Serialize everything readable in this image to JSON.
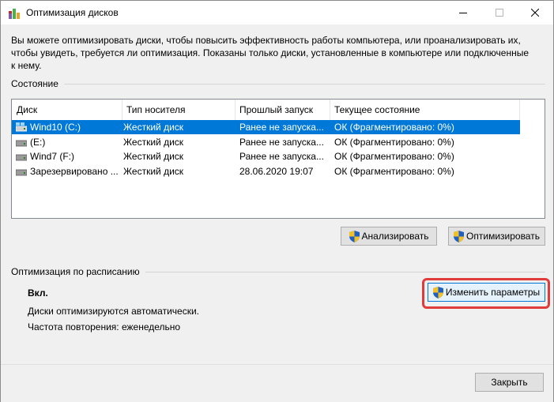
{
  "window": {
    "title": "Оптимизация дисков"
  },
  "intro": "Вы можете оптимизировать диски, чтобы повысить эффективность работы  компьютера, или проанализировать их, чтобы увидеть, требуется ли оптимизация. Показаны только диски, установленные в компьютере или подключенные к нему.",
  "status": {
    "label": "Состояние",
    "columns": [
      "Диск",
      "Тип носителя",
      "Прошлый запуск",
      "Текущее состояние"
    ],
    "rows": [
      {
        "disk": "Wind10 (C:)",
        "media": "Жесткий диск",
        "last_run": "Ранее не запуска...",
        "state": "ОК (Фрагментировано: 0%)",
        "icon": "windows-drive-icon"
      },
      {
        "disk": "(E:)",
        "media": "Жесткий диск",
        "last_run": "Ранее не запуска...",
        "state": "ОК (Фрагментировано: 0%)",
        "icon": "drive-icon"
      },
      {
        "disk": "Wind7 (F:)",
        "media": "Жесткий диск",
        "last_run": "Ранее не запуска...",
        "state": "ОК (Фрагментировано: 0%)",
        "icon": "drive-icon"
      },
      {
        "disk": "Зарезервировано ...",
        "media": "Жесткий диск",
        "last_run": "28.06.2020 19:07",
        "state": "ОК (Фрагментировано: 0%)",
        "icon": "drive-icon"
      }
    ],
    "analyze_label": "Анализировать",
    "optimize_label": "Оптимизировать"
  },
  "schedule": {
    "label": "Оптимизация по расписанию",
    "state": "Вкл.",
    "description": "Диски оптимизируются автоматически.",
    "frequency": "Частота повторения: еженедельно",
    "change_label": "Изменить параметры"
  },
  "footer": {
    "close_label": "Закрыть"
  },
  "colors": {
    "selection": "#0078d7",
    "highlight": "#e03c3c"
  }
}
